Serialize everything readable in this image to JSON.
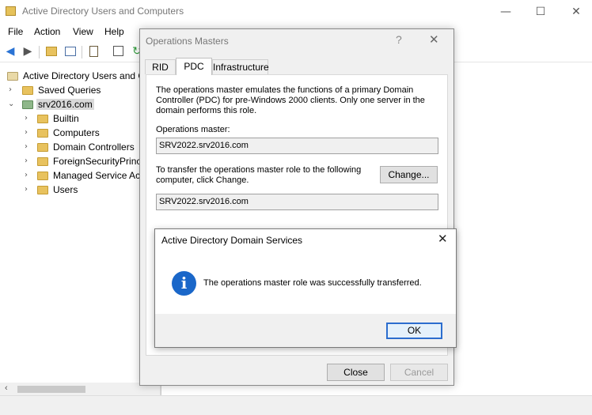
{
  "main": {
    "title": "Active Directory Users and Computers",
    "window_buttons": {
      "minimize": "—",
      "maximize": "☐",
      "close": "✕"
    },
    "menu": [
      "File",
      "Action",
      "View",
      "Help"
    ]
  },
  "tree": {
    "root": "Active Directory Users and C",
    "saved_queries": "Saved Queries",
    "domain": "srv2016.com",
    "children": [
      "Builtin",
      "Computers",
      "Domain Controllers",
      "ForeignSecurityPrinc",
      "Managed Service Acc",
      "Users"
    ]
  },
  "opm": {
    "title": "Operations Masters",
    "help": "?",
    "close": "✕",
    "tabs": [
      "RID",
      "PDC",
      "Infrastructure"
    ],
    "description": "The operations master emulates the functions of a primary Domain Controller (PDC) for pre-Windows 2000 clients. Only one server in the domain performs this role.",
    "master_label": "Operations master:",
    "master_value": "SRV2022.srv2016.com",
    "transfer_label": "To transfer the operations master role to the following computer, click Change.",
    "change_button": "Change...",
    "target_value": "SRV2022.srv2016.com",
    "close_button": "Close",
    "cancel_button": "Cancel"
  },
  "msg": {
    "title": "Active Directory Domain Services",
    "close": "✕",
    "icon": "i",
    "text": "The operations master role was successfully transferred.",
    "ok_button": "OK"
  },
  "icons": {
    "back": "arrow-left-icon",
    "forward": "arrow-right-icon",
    "info": "info-icon"
  },
  "colors": {
    "info_blue": "#1a67c9",
    "ok_border": "#2c6dce",
    "folder": "#e8c25e"
  }
}
